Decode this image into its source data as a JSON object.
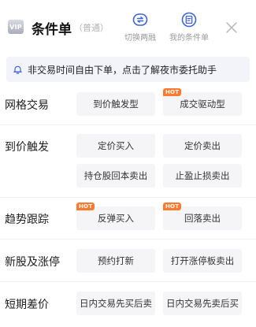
{
  "header": {
    "vip_label": "VIP",
    "title": "条件单",
    "subtitle": "（普通）",
    "switch_label": "切换两融",
    "my_orders_label": "我的条件单"
  },
  "notice": {
    "text": "非交易时间自由下单，点击了解夜市委托助手"
  },
  "hot_label": "HOT",
  "rows": [
    {
      "label": "网格交易",
      "buttons": [
        {
          "label": "到价触发型",
          "hot": false
        },
        {
          "label": "成交驱动型",
          "hot": true
        }
      ]
    },
    {
      "label": "到价触发",
      "buttons": [
        {
          "label": "定价买入",
          "hot": false
        },
        {
          "label": "定价卖出",
          "hot": false
        },
        {
          "label": "持仓股回本卖出",
          "hot": false
        },
        {
          "label": "止盈止损卖出",
          "hot": false
        }
      ]
    },
    {
      "label": "趋势跟踪",
      "buttons": [
        {
          "label": "反弹买入",
          "hot": true
        },
        {
          "label": "回落卖出",
          "hot": true
        }
      ]
    },
    {
      "label": "新股及涨停",
      "buttons": [
        {
          "label": "预约打新",
          "hot": false
        },
        {
          "label": "打开涨停板卖出",
          "hot": false
        }
      ]
    },
    {
      "label": "短期差价",
      "buttons": [
        {
          "label": "日内交易先买后卖",
          "hot": false
        },
        {
          "label": "日内交易先卖后买",
          "hot": false
        }
      ]
    }
  ],
  "colors": {
    "hot_badge": "#ff7a2f",
    "icon_blue": "#3e64d6",
    "notice_bg": "#f2f4fa",
    "button_bg": "#f5f5f7"
  },
  "icons": [
    "vip-badge",
    "switch-icon",
    "my-orders-icon",
    "close-icon",
    "bell-icon"
  ]
}
